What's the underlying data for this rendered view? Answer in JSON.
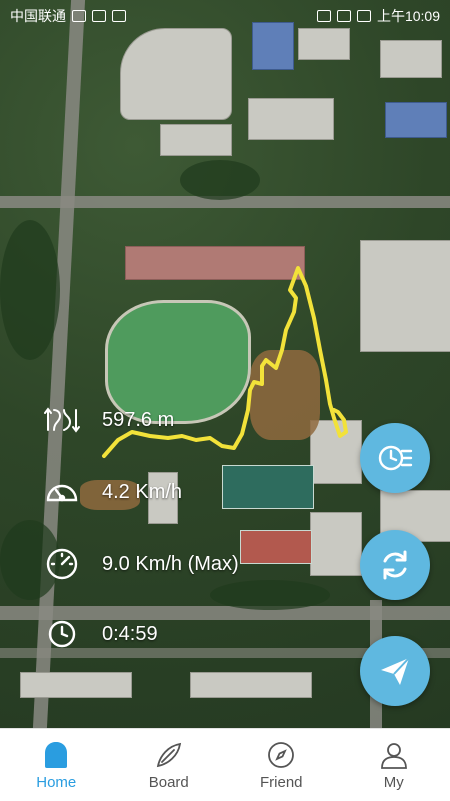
{
  "status_bar": {
    "carrier": "中国联通",
    "time": "上午10:09"
  },
  "map": {
    "type": "satellite",
    "route_color": "#f2e23a"
  },
  "stats": {
    "distance": "597.6 m",
    "avg_speed": "4.2 Km/h",
    "max_speed": "9.0 Km/h (Max)",
    "duration": "0:4:59"
  },
  "fabs": {
    "accent": "#5fb8e0",
    "items": [
      "clock-list-icon",
      "refresh-icon",
      "send-icon"
    ]
  },
  "nav": {
    "items": [
      {
        "label": "Home",
        "icon": "home-icon",
        "active": true
      },
      {
        "label": "Board",
        "icon": "board-icon",
        "active": false
      },
      {
        "label": "Friend",
        "icon": "compass-icon",
        "active": false
      },
      {
        "label": "My",
        "icon": "user-icon",
        "active": false
      }
    ],
    "active_color": "#2a9de0"
  }
}
